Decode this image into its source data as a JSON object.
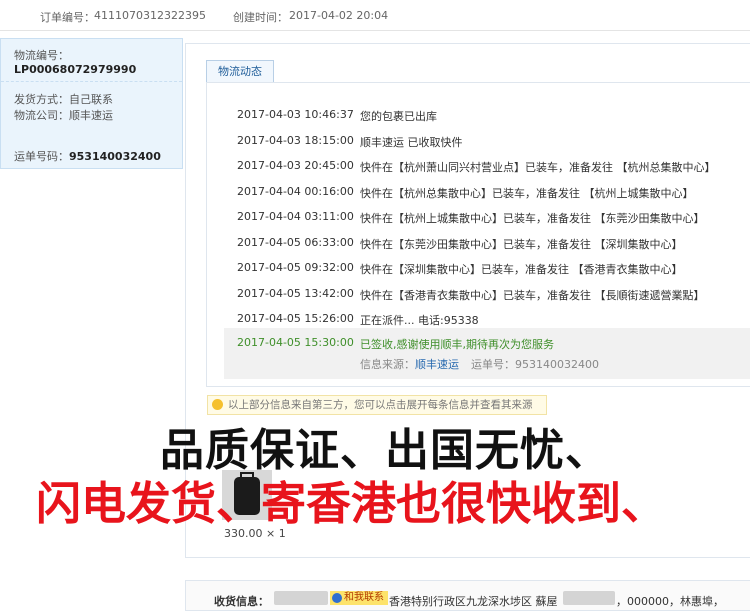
{
  "order": {
    "number_label": "订单编号：",
    "number": "4111070312322395",
    "created_label": "创建时间：",
    "created": "2017-04-02 20:04"
  },
  "logistics": {
    "id_label": "物流编号：",
    "id": "LP00068072979990",
    "ship_method_label": "发货方式：",
    "ship_method": "自己联系",
    "company_label": "物流公司：",
    "company": "顺丰速运",
    "waybill_label": "运单号码：",
    "waybill": "953140032400"
  },
  "tab_label": "物流动态",
  "tracking": [
    {
      "time": "2017-04-03 10:46:37",
      "desc": "您的包裹已出库"
    },
    {
      "time": "2017-04-03 18:15:00",
      "desc": "顺丰速运 已收取快件"
    },
    {
      "time": "2017-04-03 20:45:00",
      "desc": "快件在【杭州萧山同兴村营业点】已装车，准备发往 【杭州总集散中心】"
    },
    {
      "time": "2017-04-04 00:16:00",
      "desc": "快件在【杭州总集散中心】已装车，准备发往 【杭州上城集散中心】"
    },
    {
      "time": "2017-04-04 03:11:00",
      "desc": "快件在【杭州上城集散中心】已装车，准备发往 【东莞沙田集散中心】"
    },
    {
      "time": "2017-04-05 06:33:00",
      "desc": "快件在【东莞沙田集散中心】已装车，准备发往 【深圳集散中心】"
    },
    {
      "time": "2017-04-05 09:32:00",
      "desc": "快件在【深圳集散中心】已装车，准备发往 【香港青衣集散中心】"
    },
    {
      "time": "2017-04-05 13:42:00",
      "desc": "快件在【香港青衣集散中心】已装车，准备发往 【長順街速遞營業點】"
    },
    {
      "time": "2017-04-05 15:26:00",
      "desc": "正在派件... 电话:95338"
    }
  ],
  "latest": {
    "time": "2017-04-05 15:30:00",
    "desc": "已签收,感谢使用顺丰,期待再次为您服务",
    "source_label": "信息来源：",
    "source": "顺丰速运",
    "waybill_label": "运单号：",
    "waybill": "953140032400"
  },
  "notice": "以上部分信息来自第三方，您可以点击展开每条信息并查看其来源",
  "product": {
    "price": "330.00 × 1"
  },
  "overlay": {
    "line1": "品质保证、出国无忧、",
    "line2": "闪电发货、寄香港也很快收到、"
  },
  "receiver": {
    "label": "收货信息：",
    "contact_badge": "和我联系",
    "address_part1": "香港特别行政区九龙深水埗区 蘇屋",
    "address_part2": "，000000，林惠埠，"
  },
  "colors": {
    "accent_blue": "#2a6bb0",
    "green": "#3f8f2a",
    "overlay_red": "#e8141c"
  }
}
